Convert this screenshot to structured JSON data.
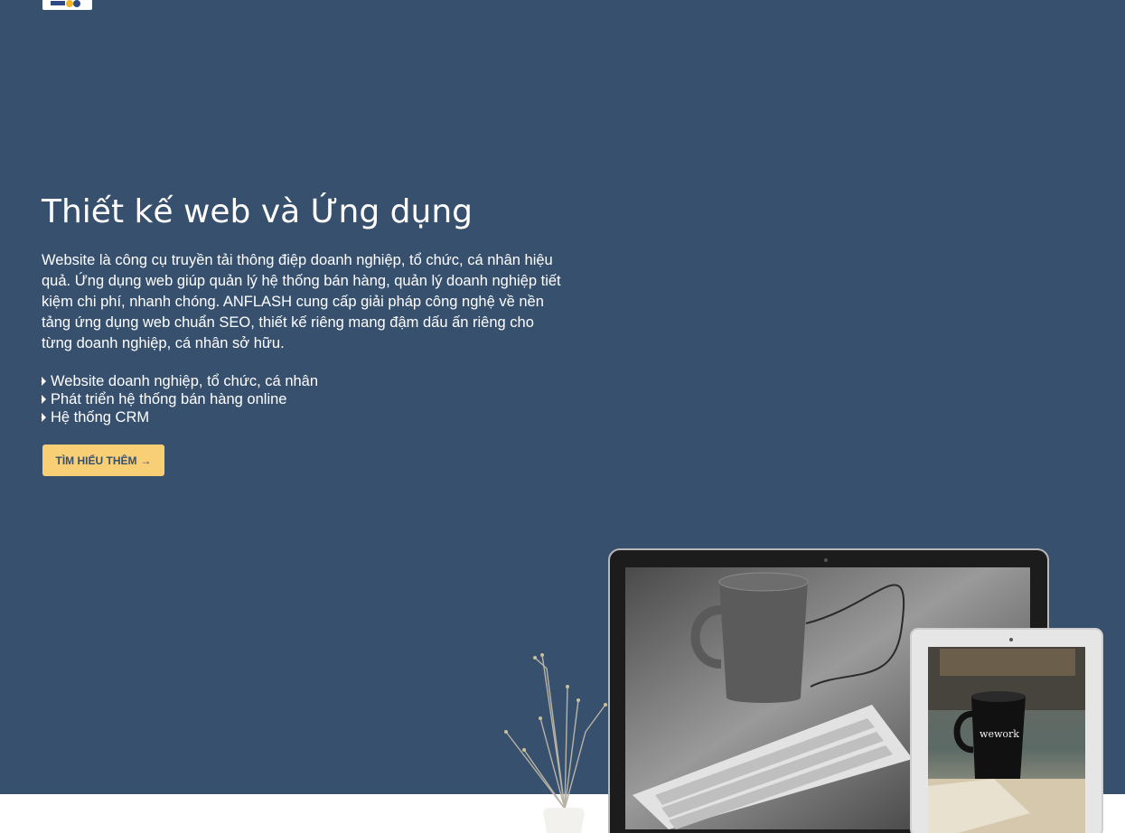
{
  "hero": {
    "title": "Thiết kế web và Ứng dụng",
    "description": "Website là công cụ truyền tải thông điệp doanh nghiệp, tổ chức, cá nhân hiệu quả. Ứng dụng web giúp quản lý hệ thống bán hàng, quản lý doanh nghiệp tiết kiệm chi phí, nhanh chóng. ANFLASH cung cấp giải pháp công nghệ về nền tảng ứng dụng web chuẩn SEO, thiết kế riêng mang đậm dấu ấn riêng cho từng doanh nghiệp, cá nhân sở hữu.",
    "features": [
      "Website doanh nghiệp, tổ chức, cá nhân",
      "Phát triển hệ thống bán hàng online",
      "Hệ thống CRM"
    ],
    "cta_label": "TÌM HIỂU THÊM",
    "cta_arrow": "→",
    "mug_brand": "wework"
  },
  "colors": {
    "background": "#37506e",
    "accent": "#f9cf75",
    "text": "#ffffff"
  },
  "icons": {
    "logo": "company-logo",
    "bullet": "caret-right-icon",
    "cta_arrow": "arrow-right-icon"
  }
}
